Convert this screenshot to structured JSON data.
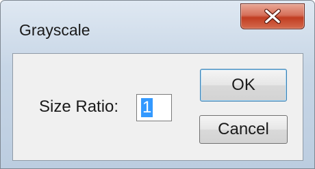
{
  "dialog": {
    "title": "Grayscale",
    "close_icon": "close-x-icon",
    "size_ratio_label": "Size Ratio:",
    "size_ratio_value": "1",
    "ok_label": "OK",
    "cancel_label": "Cancel"
  },
  "colors": {
    "close_button": "#c13d22",
    "selection_highlight": "#3399ff",
    "default_button_border": "#3c7fb1"
  }
}
